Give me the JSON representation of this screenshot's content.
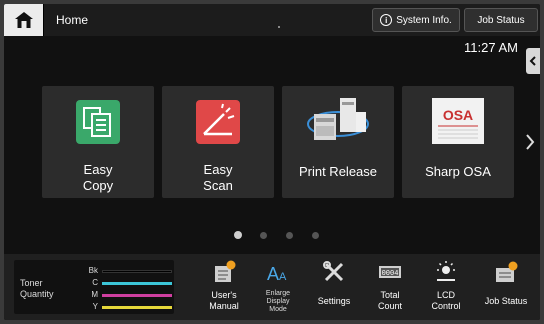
{
  "topbar": {
    "title": "Home",
    "system_info_label": "System Info.",
    "job_status_label": "Job Status"
  },
  "clock": "11:27 AM",
  "tiles": [
    {
      "line1": "Easy",
      "line2": "Copy",
      "icon": "copy-icon",
      "color": "#3aa86a"
    },
    {
      "line1": "Easy",
      "line2": "Scan",
      "icon": "scan-icon",
      "color": "#e04848"
    },
    {
      "line1": "Print Release",
      "icon": "printer-icon"
    },
    {
      "line1": "Sharp OSA",
      "icon": "osa-logo-icon"
    }
  ],
  "pager": {
    "pages": 4,
    "current": 1
  },
  "toner": {
    "title_line1": "Toner",
    "title_line2": "Quantity",
    "rows": [
      {
        "label": "Bk",
        "color": "#000000"
      },
      {
        "label": "C",
        "color": "#3cc6d8"
      },
      {
        "label": "M",
        "color": "#d03fa0"
      },
      {
        "label": "Y",
        "color": "#e6d83a"
      }
    ]
  },
  "bottom_items": [
    {
      "line1": "User's",
      "line2": "Manual",
      "icon": "manual-icon"
    },
    {
      "line1": "Enlarge",
      "line2": "Display",
      "line3": "Mode",
      "icon": "enlarge-text-icon"
    },
    {
      "line1": "Settings",
      "icon": "settings-tools-icon"
    },
    {
      "line1": "Total",
      "line2": "Count",
      "icon": "counter-icon"
    },
    {
      "line1": "LCD",
      "line2": "Control",
      "icon": "brightness-icon"
    },
    {
      "line1": "Job Status",
      "icon": "job-status-icon"
    }
  ]
}
